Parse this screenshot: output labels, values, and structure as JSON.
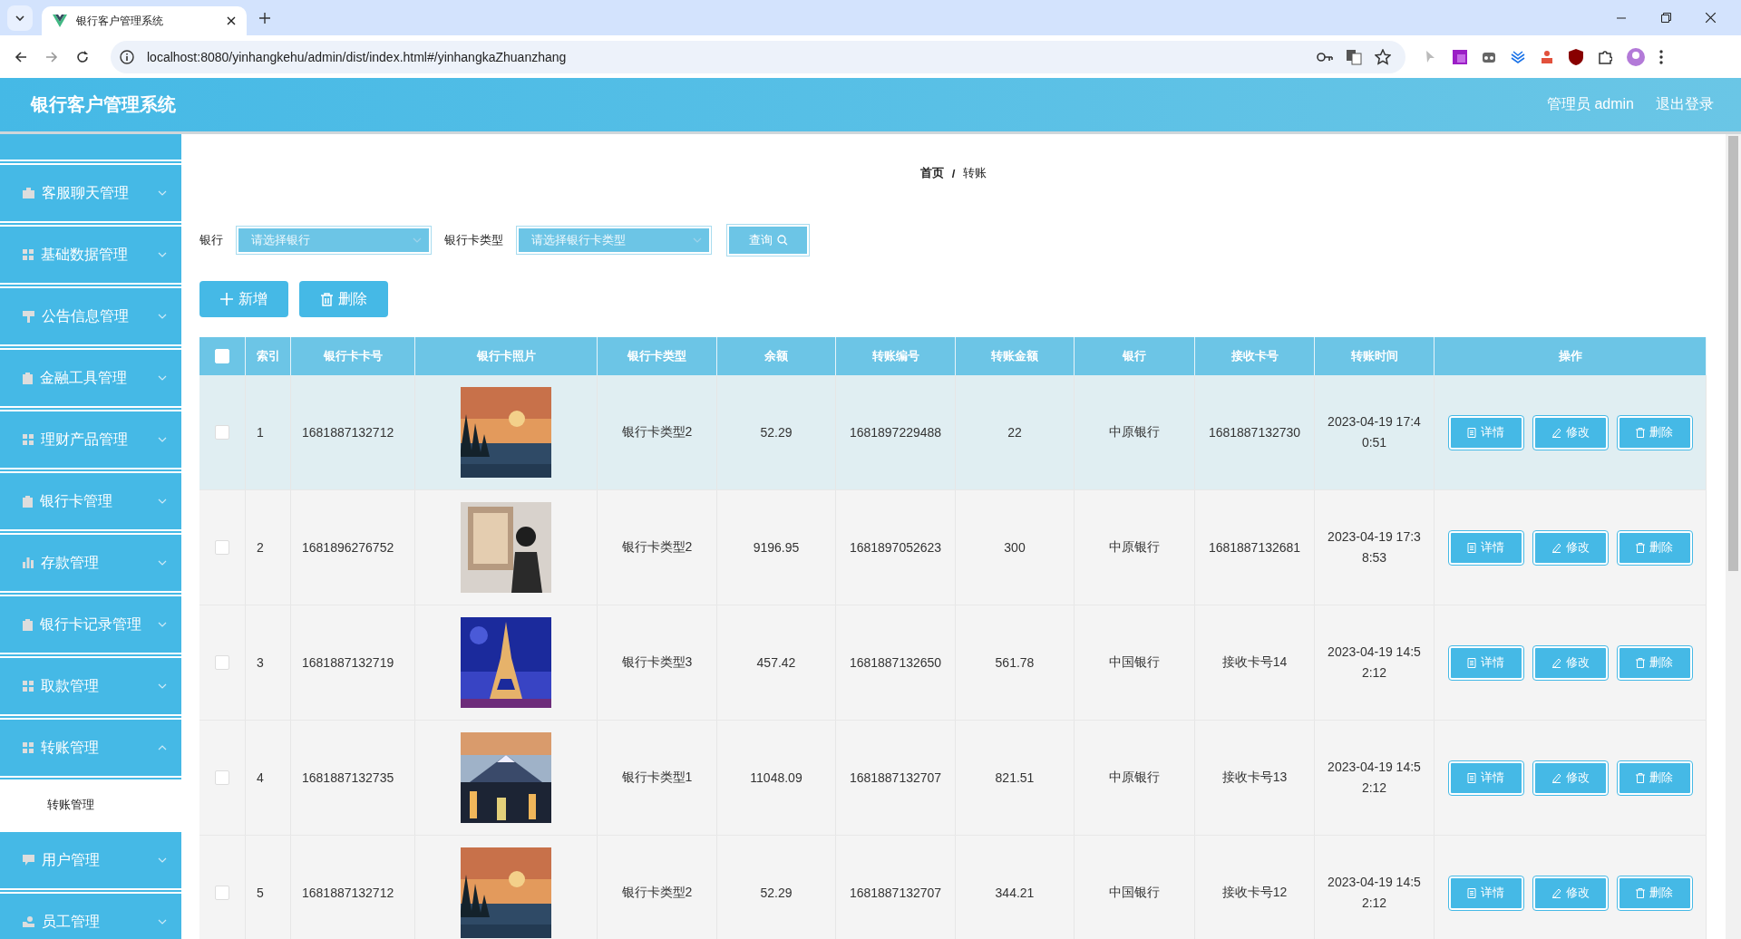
{
  "browser": {
    "tab_title": "银行客户管理系统",
    "url": "localhost:8080/yinhangkehu/admin/dist/index.html#/yinhangkaZhuanzhang"
  },
  "header": {
    "title": "银行客户管理系统",
    "user": "管理员 admin",
    "logout": "退出登录"
  },
  "sidebar": {
    "items": [
      {
        "label": "客服聊天管理",
        "expanded": false
      },
      {
        "label": "基础数据管理",
        "expanded": false
      },
      {
        "label": "公告信息管理",
        "expanded": false
      },
      {
        "label": "金融工具管理",
        "expanded": false
      },
      {
        "label": "理财产品管理",
        "expanded": false
      },
      {
        "label": "银行卡管理",
        "expanded": false
      },
      {
        "label": "存款管理",
        "expanded": false
      },
      {
        "label": "银行卡记录管理",
        "expanded": false
      },
      {
        "label": "取款管理",
        "expanded": false
      },
      {
        "label": "转账管理",
        "expanded": true,
        "children": [
          {
            "label": "转账管理",
            "selected": true
          }
        ]
      },
      {
        "label": "用户管理",
        "expanded": false
      },
      {
        "label": "员工管理",
        "expanded": false
      }
    ]
  },
  "breadcrumb": {
    "items": [
      "首页",
      "转账"
    ],
    "separator": "/"
  },
  "filters": [
    {
      "label": "银行",
      "placeholder": "请选择银行"
    },
    {
      "label": "银行卡类型",
      "placeholder": "请选择银行卡类型"
    }
  ],
  "search_button": "查询",
  "actions": [
    {
      "kind": "add",
      "label": "新增"
    },
    {
      "kind": "delete",
      "label": "删除"
    }
  ],
  "table": {
    "header_checked": false,
    "columns": [
      "索引",
      "银行卡卡号",
      "银行卡照片",
      "银行卡类型",
      "余额",
      "转账编号",
      "转账金额",
      "银行",
      "接收卡号",
      "转账时间",
      "操作"
    ],
    "rows": [
      {
        "selected": true,
        "checked": false,
        "index": "1",
        "card_no": "1681887132712",
        "type": "银行卡类型2",
        "balance": "52.29",
        "transfer_no": "1681897229488",
        "amount": "22",
        "bank": "中原银行",
        "recv_no": "1681887132730",
        "time": "2023-04-19 17:40:51",
        "buttons": [
          "详情",
          "修改",
          "删除"
        ]
      },
      {
        "selected": false,
        "checked": false,
        "index": "2",
        "card_no": "1681896276752",
        "type": "银行卡类型2",
        "balance": "9196.95",
        "transfer_no": "1681897052623",
        "amount": "300",
        "bank": "中原银行",
        "recv_no": "1681887132681",
        "time": "2023-04-19 17:38:53",
        "buttons": [
          "详情",
          "修改",
          "删除"
        ]
      },
      {
        "selected": false,
        "checked": false,
        "index": "3",
        "card_no": "1681887132719",
        "type": "银行卡类型3",
        "balance": "457.42",
        "transfer_no": "1681887132650",
        "amount": "561.78",
        "bank": "中国银行",
        "recv_no": "接收卡号14",
        "time": "2023-04-19 14:52:12",
        "buttons": [
          "详情",
          "修改",
          "删除"
        ]
      },
      {
        "selected": false,
        "checked": false,
        "index": "4",
        "card_no": "1681887132735",
        "type": "银行卡类型1",
        "balance": "11048.09",
        "transfer_no": "1681887132707",
        "amount": "821.51",
        "bank": "中原银行",
        "recv_no": "接收卡号13",
        "time": "2023-04-19 14:52:12",
        "buttons": [
          "详情",
          "修改",
          "删除"
        ]
      },
      {
        "selected": false,
        "checked": false,
        "index": "5",
        "card_no": "1681887132712",
        "type": "银行卡类型2",
        "balance": "52.29",
        "transfer_no": "1681887132707",
        "amount": "344.21",
        "bank": "中国银行",
        "recv_no": "接收卡号12",
        "time": "2023-04-19 14:52:12",
        "buttons": [
          "详情",
          "修改",
          "删除"
        ]
      }
    ]
  }
}
